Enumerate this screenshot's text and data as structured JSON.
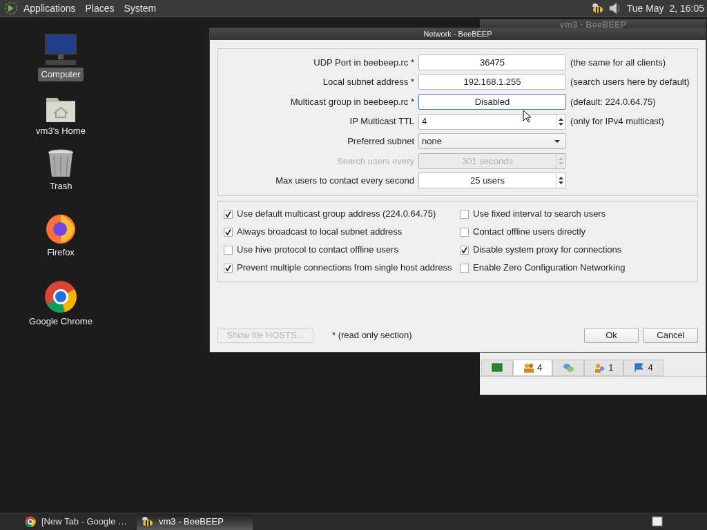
{
  "top_panel": {
    "menus": [
      "Applications",
      "Places",
      "System"
    ],
    "clock": "Tue May  2, 16:05"
  },
  "desktop_icons": [
    {
      "kind": "computer",
      "label": "Computer",
      "selected": true
    },
    {
      "kind": "home",
      "label": "vm3's Home",
      "selected": false
    },
    {
      "kind": "trash",
      "label": "Trash",
      "selected": false
    },
    {
      "kind": "firefox",
      "label": "Firefox",
      "selected": false
    },
    {
      "kind": "chrome",
      "label": "Google Chrome",
      "selected": false
    }
  ],
  "background_window": {
    "title": "vm3 - BeeBEEP",
    "tabs": [
      {
        "kind": "monitor",
        "selected": false
      },
      {
        "kind": "users",
        "count": "4",
        "selected": true
      },
      {
        "kind": "chat",
        "selected": false
      },
      {
        "kind": "group",
        "count": "1",
        "selected": false
      },
      {
        "kind": "flag",
        "count": "4",
        "selected": false
      }
    ]
  },
  "dialog": {
    "title": "Network - BeeBEEP",
    "fields": [
      {
        "kind": "text",
        "label": "UDP Port in beebeep.rc *",
        "value": "36475",
        "hint": "(the same for all clients)",
        "disabled": false,
        "focused": false
      },
      {
        "kind": "text",
        "label": "Local subnet address *",
        "value": "192.168.1.255",
        "hint": "(search users here by default)",
        "disabled": false,
        "focused": false
      },
      {
        "kind": "text",
        "label": "Multicast group in beebeep.rc *",
        "value": "Disabled",
        "hint": "(default: 224.0.64.75)",
        "disabled": false,
        "focused": true
      },
      {
        "kind": "spin_left",
        "label": "IP Multicast TTL",
        "value": "4",
        "hint": "(only for IPv4 multicast)",
        "disabled": false,
        "focused": false
      },
      {
        "kind": "select",
        "label": "Preferred subnet",
        "value": "none",
        "disabled": false,
        "focused": false
      },
      {
        "kind": "spin",
        "label": "Search users every",
        "value": "301 seconds",
        "disabled": true,
        "focused": false
      },
      {
        "kind": "spin",
        "label": "Max users to contact every second",
        "value": "25 users",
        "disabled": false,
        "focused": false
      }
    ],
    "checkboxes": [
      {
        "label": "Use default multicast group address (224.0.64.75)",
        "checked": true
      },
      {
        "label": "Use fixed interval to search users",
        "checked": false
      },
      {
        "label": "Always broadcast to local subnet address",
        "checked": true
      },
      {
        "label": "Contact offline users directly",
        "checked": false
      },
      {
        "label": "Use hive protocol to contact offline users",
        "checked": false
      },
      {
        "label": "Disable system proxy for connections",
        "checked": true
      },
      {
        "label": "Prevent multiple connections from single host address",
        "checked": true
      },
      {
        "label": "Enable Zero Configuration Networking",
        "checked": false
      }
    ],
    "hosts_button": {
      "label": "Show file HOSTS...",
      "disabled": true
    },
    "note": "* (read only section)",
    "buttons": [
      "Ok",
      "Cancel"
    ]
  },
  "taskbar": {
    "items": [
      {
        "kind": "chrome",
        "label": "[New Tab - Google …",
        "selected": false
      },
      {
        "kind": "bee",
        "label": "vm3 - BeeBEEP",
        "selected": true
      }
    ]
  }
}
